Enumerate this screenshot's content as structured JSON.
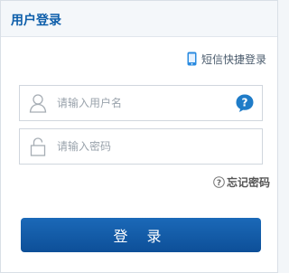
{
  "header": {
    "title": "用户登录"
  },
  "sms_login": {
    "label": "短信快捷登录",
    "icon": "phone-icon"
  },
  "username": {
    "placeholder": "请输入用户名",
    "icon": "user-icon",
    "help_icon": "help-icon"
  },
  "password": {
    "placeholder": "请输入密码",
    "icon": "lock-icon"
  },
  "forgot": {
    "label": "忘记密码",
    "icon": "question-icon"
  },
  "login_button": {
    "label": "登 录"
  },
  "colors": {
    "accent": "#0d5eaa",
    "button": "#1458a6",
    "border": "#d0d6dd"
  }
}
